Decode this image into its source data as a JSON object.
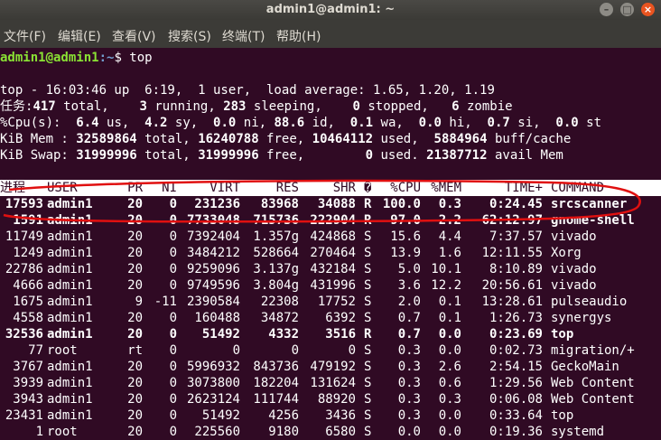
{
  "window": {
    "title": "admin1@admin1: ~"
  },
  "menu": [
    "文件(F)",
    "编辑(E)",
    "查看(V)",
    "搜索(S)",
    "终端(T)",
    "帮助(H)"
  ],
  "prompt": {
    "user_host": "admin1@admin1",
    "path": ":~",
    "symbol": "$ ",
    "command": "top"
  },
  "summary": {
    "line1": "top - 16:03:46 up  6:19,  1 user,  load average: 1.65, 1.20, 1.19",
    "tasks": {
      "label": "任务:",
      "total": "417",
      "total_label": " total,",
      "running": "3",
      "running_label": " running,",
      "sleeping": "283",
      "sleeping_label": " sleeping,",
      "stopped": "0",
      "stopped_label": " stopped,",
      "zombie": "6",
      "zombie_label": " zombie"
    },
    "cpu": {
      "label": "%Cpu(s):",
      "us": "6.4",
      "us_label": " us,",
      "sy": "4.2",
      "sy_label": " sy,",
      "ni": "0.0",
      "ni_label": " ni,",
      "id": "88.6",
      "id_label": " id,",
      "wa": "0.1",
      "wa_label": " wa,",
      "hi": "0.0",
      "hi_label": " hi,",
      "si": "0.7",
      "si_label": " si,",
      "st": "0.0",
      "st_label": " st"
    },
    "mem": {
      "label": "KiB Mem :",
      "total": "32589864",
      "total_label": " total,",
      "free": "16240788",
      "free_label": " free,",
      "used": "10464112",
      "used_label": " used,",
      "buff": "5884964",
      "buff_label": " buff/cache"
    },
    "swap": {
      "label": "KiB Swap:",
      "total": "31999996",
      "total_label": " total,",
      "free": "31999996",
      "free_label": " free,",
      "used": "0",
      "used_label": " used.",
      "avail": "21387712",
      "avail_label": " avail Mem"
    }
  },
  "columns": [
    "进程",
    "USER",
    "PR",
    "NI",
    "VIRT",
    "RES",
    "SHR",
    "�",
    "%CPU",
    "%MEM",
    "TIME+",
    "COMMAND"
  ],
  "processes": [
    {
      "pid": "17593",
      "user": "admin1",
      "pr": "20",
      "ni": "0",
      "virt": "231236",
      "res": "83968",
      "shr": "34088",
      "s": "R",
      "cpu": "100.0",
      "mem": "0.3",
      "time": "0:24.45",
      "cmd": "srcscanner",
      "bold": true
    },
    {
      "pid": "1591",
      "user": "admin1",
      "pr": "20",
      "ni": "0",
      "virt": "7733048",
      "res": "715736",
      "shr": "222904",
      "s": "R",
      "cpu": "97.0",
      "mem": "2.2",
      "time": "62:12.97",
      "cmd": "gnome-shell",
      "bold": true
    },
    {
      "pid": "11749",
      "user": "admin1",
      "pr": "20",
      "ni": "0",
      "virt": "7392404",
      "res": "1.357g",
      "shr": "424868",
      "s": "S",
      "cpu": "15.6",
      "mem": "4.4",
      "time": "7:37.57",
      "cmd": "vivado",
      "bold": false
    },
    {
      "pid": "1249",
      "user": "admin1",
      "pr": "20",
      "ni": "0",
      "virt": "3484212",
      "res": "528664",
      "shr": "270464",
      "s": "S",
      "cpu": "13.9",
      "mem": "1.6",
      "time": "12:11.55",
      "cmd": "Xorg",
      "bold": false
    },
    {
      "pid": "22786",
      "user": "admin1",
      "pr": "20",
      "ni": "0",
      "virt": "9259096",
      "res": "3.137g",
      "shr": "432184",
      "s": "S",
      "cpu": "5.0",
      "mem": "10.1",
      "time": "8:10.89",
      "cmd": "vivado",
      "bold": false
    },
    {
      "pid": "4666",
      "user": "admin1",
      "pr": "20",
      "ni": "0",
      "virt": "9749596",
      "res": "3.804g",
      "shr": "431996",
      "s": "S",
      "cpu": "3.6",
      "mem": "12.2",
      "time": "20:56.61",
      "cmd": "vivado",
      "bold": false
    },
    {
      "pid": "1675",
      "user": "admin1",
      "pr": "9",
      "ni": "-11",
      "virt": "2390584",
      "res": "22308",
      "shr": "17752",
      "s": "S",
      "cpu": "2.0",
      "mem": "0.1",
      "time": "13:28.61",
      "cmd": "pulseaudio",
      "bold": false
    },
    {
      "pid": "4558",
      "user": "admin1",
      "pr": "20",
      "ni": "0",
      "virt": "160488",
      "res": "34872",
      "shr": "6392",
      "s": "S",
      "cpu": "0.7",
      "mem": "0.1",
      "time": "1:26.73",
      "cmd": "synergys",
      "bold": false
    },
    {
      "pid": "32536",
      "user": "admin1",
      "pr": "20",
      "ni": "0",
      "virt": "51492",
      "res": "4332",
      "shr": "3516",
      "s": "R",
      "cpu": "0.7",
      "mem": "0.0",
      "time": "0:23.69",
      "cmd": "top",
      "bold": true
    },
    {
      "pid": "77",
      "user": "root",
      "pr": "rt",
      "ni": "0",
      "virt": "0",
      "res": "0",
      "shr": "0",
      "s": "S",
      "cpu": "0.3",
      "mem": "0.0",
      "time": "0:02.73",
      "cmd": "migration/+",
      "bold": false
    },
    {
      "pid": "3767",
      "user": "admin1",
      "pr": "20",
      "ni": "0",
      "virt": "5996932",
      "res": "843736",
      "shr": "479192",
      "s": "S",
      "cpu": "0.3",
      "mem": "2.6",
      "time": "2:54.15",
      "cmd": "GeckoMain",
      "bold": false
    },
    {
      "pid": "3939",
      "user": "admin1",
      "pr": "20",
      "ni": "0",
      "virt": "3073800",
      "res": "182204",
      "shr": "131624",
      "s": "S",
      "cpu": "0.3",
      "mem": "0.6",
      "time": "1:29.56",
      "cmd": "Web Content",
      "bold": false
    },
    {
      "pid": "3943",
      "user": "admin1",
      "pr": "20",
      "ni": "0",
      "virt": "2623124",
      "res": "111744",
      "shr": "88920",
      "s": "S",
      "cpu": "0.3",
      "mem": "0.3",
      "time": "0:06.08",
      "cmd": "Web Content",
      "bold": false
    },
    {
      "pid": "23431",
      "user": "admin1",
      "pr": "20",
      "ni": "0",
      "virt": "51492",
      "res": "4256",
      "shr": "3436",
      "s": "S",
      "cpu": "0.3",
      "mem": "0.0",
      "time": "0:33.64",
      "cmd": "top",
      "bold": false
    },
    {
      "pid": "1",
      "user": "root",
      "pr": "20",
      "ni": "0",
      "virt": "225560",
      "res": "9180",
      "shr": "6580",
      "s": "S",
      "cpu": "0.0",
      "mem": "0.0",
      "time": "0:19.36",
      "cmd": "systemd",
      "bold": false
    }
  ],
  "colors": {
    "terminal_bg": "#300a24",
    "text": "#ffffff",
    "prompt_user": "#8ae234",
    "prompt_path": "#729fcf",
    "annotation": "#e01010"
  }
}
